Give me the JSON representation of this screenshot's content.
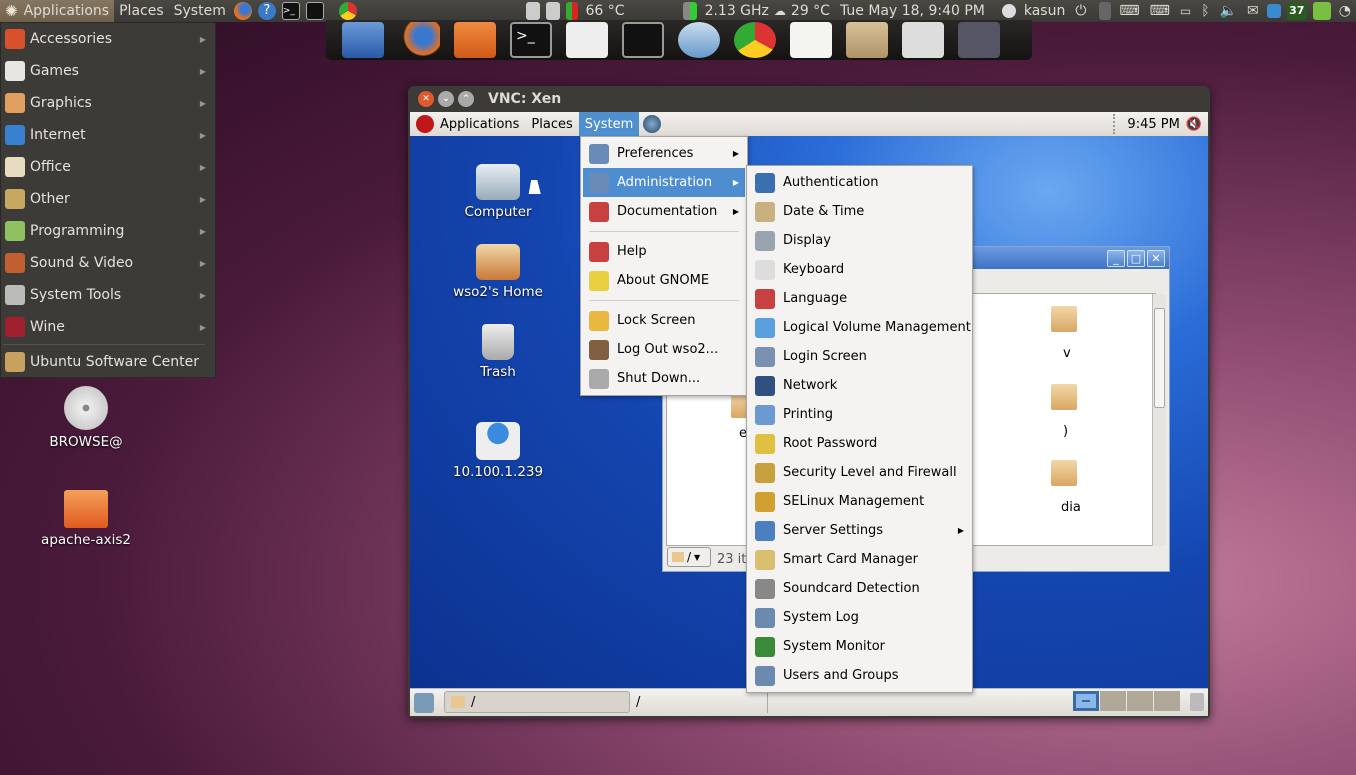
{
  "topbar": {
    "menus": [
      "Applications",
      "Places",
      "System"
    ],
    "launchers": [
      "firefox-icon",
      "help-icon",
      "terminal-icon",
      "system-monitor-icon",
      "chrome-icon"
    ],
    "temperature": "66 °C",
    "cpu_freq": "2.13 GHz",
    "weather": "29 °C",
    "clock": "Tue May 18,  9:40 PM",
    "user": "kasun",
    "tray_badge": "37"
  },
  "dock": {
    "items": [
      "install-icon",
      "firefox-icon",
      "home-folder-icon",
      "terminal-icon",
      "screenshot-icon",
      "system-monitor-icon",
      "disk-utility-icon",
      "chrome-icon",
      "text-editor-icon",
      "downloads-icon",
      "window-preview-1",
      "window-preview-2"
    ]
  },
  "app_menu": {
    "items": [
      {
        "label": "Accessories",
        "color": "#d9512c"
      },
      {
        "label": "Games",
        "color": "#e8e6e0"
      },
      {
        "label": "Graphics",
        "color": "#e0a060"
      },
      {
        "label": "Internet",
        "color": "#3a80d0"
      },
      {
        "label": "Office",
        "color": "#e8dcc0"
      },
      {
        "label": "Other",
        "color": "#c8a860"
      },
      {
        "label": "Programming",
        "color": "#90c060"
      },
      {
        "label": "Sound & Video",
        "color": "#c06030"
      },
      {
        "label": "System Tools",
        "color": "#bbbbbb"
      },
      {
        "label": "Wine",
        "color": "#a02030"
      }
    ],
    "footer": "Ubuntu Software Center"
  },
  "desktop_icons": [
    {
      "label": "BROWSE@",
      "type": "dvd"
    },
    {
      "label": "apache-axis2",
      "type": "folder"
    }
  ],
  "vnc": {
    "title": "VNC: Xen",
    "panel": {
      "menus": [
        "Applications",
        "Places",
        "System"
      ],
      "clock": "9:45 PM"
    },
    "desktop_icons": [
      {
        "label": "Computer"
      },
      {
        "label": "wso2's Home"
      },
      {
        "label": "Trash"
      },
      {
        "label": "10.100.1.239"
      }
    ],
    "system_menu": {
      "items": [
        {
          "label": "Preferences",
          "submenu": true
        },
        {
          "label": "Administration",
          "submenu": true,
          "selected": true
        },
        {
          "label": "Documentation",
          "submenu": true
        },
        {
          "label": "Help"
        },
        {
          "label": "About GNOME"
        },
        {
          "label": "Lock Screen"
        },
        {
          "label": "Log Out wso2..."
        },
        {
          "label": "Shut Down..."
        }
      ]
    },
    "admin_menu": {
      "items": [
        "Authentication",
        "Date & Time",
        "Display",
        "Keyboard",
        "Language",
        "Logical Volume Management",
        "Login Screen",
        "Network",
        "Printing",
        "Root Password",
        "Security Level and Firewall",
        "SELinux Management",
        "Server Settings",
        "Smart Card Manager",
        "Soundcard Detection",
        "System Log",
        "System Monitor",
        "Users and Groups"
      ],
      "submenu_item": "Server Settings"
    },
    "file_manager": {
      "location": "/",
      "status": "23 it",
      "visible_labels": [
        "v",
        ")",
        "dia",
        "e"
      ]
    },
    "bottom_panel": {
      "path1": "/",
      "path2": "/"
    }
  }
}
